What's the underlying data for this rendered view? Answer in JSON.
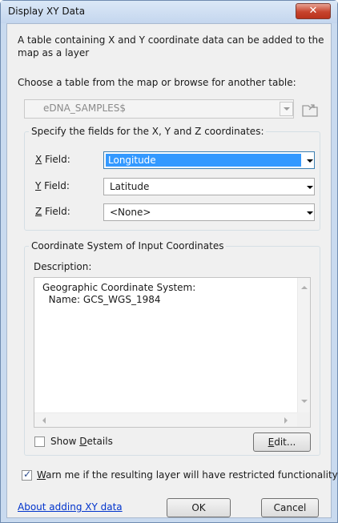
{
  "window": {
    "title": "Display XY Data",
    "close_glyph": "✕"
  },
  "intro": {
    "line1": "A table containing X and Y coordinate data can be added to the",
    "line2": "map as a layer"
  },
  "table": {
    "prompt": "Choose a table from the map or browse for another table:",
    "selected": "eDNA_SAMPLES$"
  },
  "fields_group": {
    "legend": "Specify the fields for the X, Y and Z coordinates:",
    "x_label_mn": "X",
    "x_label_rest": " Field:",
    "x_value": "Longitude",
    "y_label_mn": "Y",
    "y_label_rest": " Field:",
    "y_value": "Latitude",
    "z_label_mn": "Z",
    "z_label_rest": " Field:",
    "z_value": "<None>"
  },
  "coord_group": {
    "legend": "Coordinate System of Input Coordinates",
    "description_label": "Description:",
    "description_line1": "Geographic Coordinate System:",
    "description_line2": "  Name: GCS_WGS_1984",
    "show_details_pre": "Show ",
    "show_details_mn": "D",
    "show_details_post": "etails",
    "show_details_checked": false,
    "edit_mn": "E",
    "edit_rest": "dit..."
  },
  "warn": {
    "checked": true,
    "mn": "W",
    "rest": "arn me if the resulting layer will have restricted functionality"
  },
  "footer": {
    "help_link": "About adding XY data",
    "ok_label": "OK",
    "cancel_label": "Cancel"
  },
  "colors": {
    "selection": "#3399ff",
    "link": "#0033cc"
  }
}
